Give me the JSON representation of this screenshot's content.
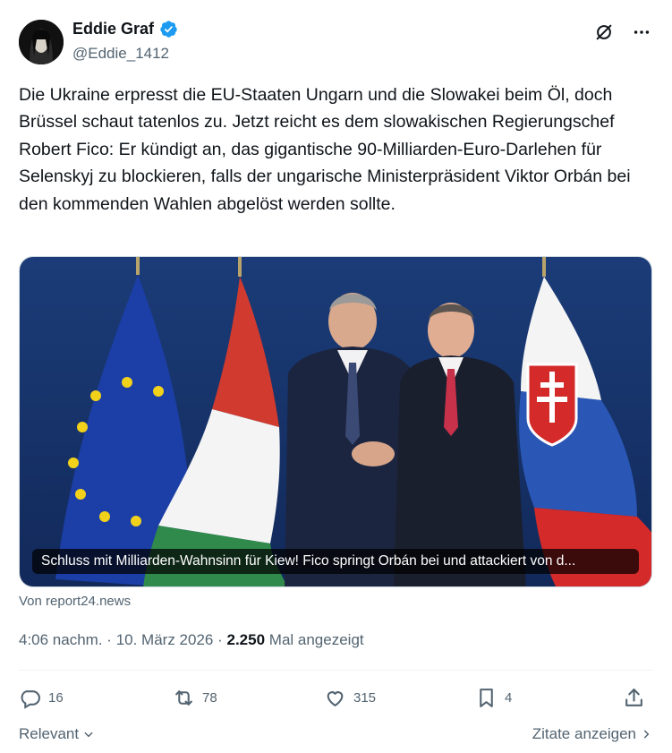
{
  "author": {
    "name": "Eddie Graf",
    "handle": "@Eddie_1412",
    "verified": true
  },
  "tweet": {
    "text": "Die Ukraine erpresst die EU-Staaten Ungarn und die Slowakei beim Öl, doch Brüssel schaut tatenlos zu. Jetzt reicht es dem slowakischen Regierungschef Robert Fico: Er kündigt an, das gigantische 90-Milliarden-Euro-Darlehen für Selenskyj zu blockieren, falls der ungarische Ministerpräsident Viktor Orbán bei den kommenden Wahlen abgelöst werden sollte."
  },
  "card": {
    "caption": "Schluss mit Milliarden-Wahnsinn für Kiew! Fico springt Orbán bei und attackiert von d...",
    "source": "Von report24.news"
  },
  "meta": {
    "time": "4:06 nachm.",
    "date": "10. März 2026",
    "views_count": "2.250",
    "views_label": "Mal angezeigt"
  },
  "actions": {
    "replies": "16",
    "reposts": "78",
    "likes": "315",
    "bookmarks": "4"
  },
  "footer": {
    "sort_label": "Relevant",
    "quotes_label": "Zitate anzeigen"
  },
  "colors": {
    "text": "#0f1419",
    "muted": "#536471",
    "verified": "#1d9bf0",
    "backdrop": "#1f3f7a"
  }
}
